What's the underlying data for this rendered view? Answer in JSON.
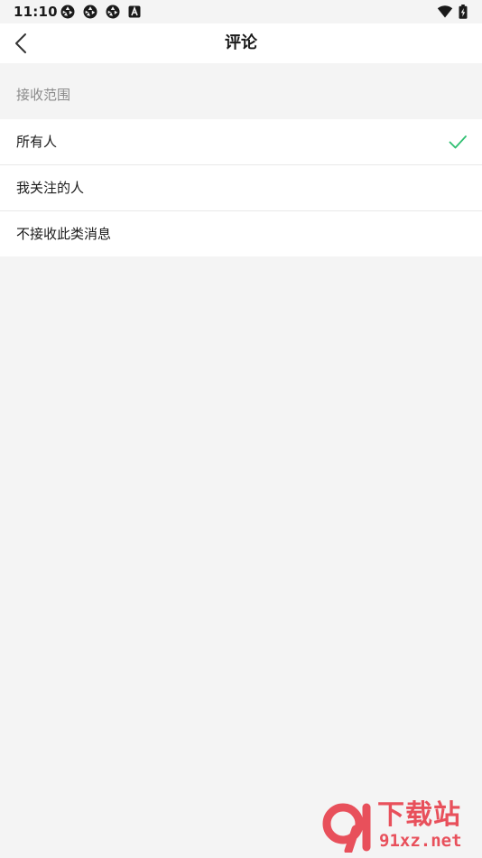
{
  "status_bar": {
    "time": "11:10",
    "notification_icons": [
      "aperture-icon",
      "aperture-icon",
      "aperture-icon",
      "a-box-icon"
    ],
    "system_icons": [
      "wifi-icon",
      "battery-charging-icon"
    ]
  },
  "nav": {
    "title": "评论",
    "back_icon": "chevron-left-icon"
  },
  "section": {
    "label": "接收范围"
  },
  "options": [
    {
      "label": "所有人",
      "selected": true
    },
    {
      "label": "我关注的人",
      "selected": false
    },
    {
      "label": "不接收此类消息",
      "selected": false
    }
  ],
  "colors": {
    "accent": "#2fbf71",
    "background": "#f4f4f4",
    "watermark": "#e8505b"
  },
  "watermark": {
    "name": "下载站",
    "domain": "91xz.net",
    "logo_text": "91"
  }
}
